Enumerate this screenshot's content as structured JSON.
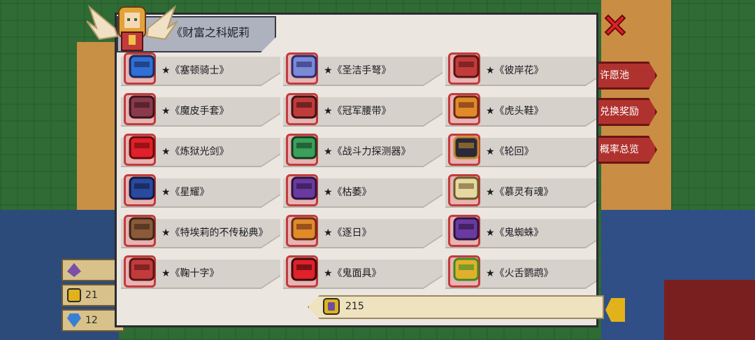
{
  "panel": {
    "title": "《财富之科妮莉",
    "title_full": "《财富之科妮莉亚》"
  },
  "side_menu": [
    {
      "label": "许愿池"
    },
    {
      "label": "兑换奖励"
    },
    {
      "label": "概率总览"
    }
  ],
  "currencies": [
    {
      "icon": "purple-gem-icon",
      "value": ""
    },
    {
      "icon": "gold-coin-icon",
      "value": "21"
    },
    {
      "icon": "blue-diamond-icon",
      "value": "12"
    }
  ],
  "items": [
    {
      "name": "★《塞顿骑士》",
      "icon": "blue-knight-helmet-icon"
    },
    {
      "name": "★《圣洁手弩》",
      "icon": "holy-crossbow-icon"
    },
    {
      "name": "★《彼岸花》",
      "icon": "red-spider-lily-icon"
    },
    {
      "name": "★《魔皮手套》",
      "icon": "demon-glove-icon"
    },
    {
      "name": "★《冠军腰带》",
      "icon": "champion-belt-icon"
    },
    {
      "name": "★《虎头鞋》",
      "icon": "tiger-head-shoe-icon"
    },
    {
      "name": "★《炼狱光剑》",
      "icon": "purgatory-lightsaber-icon"
    },
    {
      "name": "★《战斗力探测器》",
      "icon": "power-scanner-icon"
    },
    {
      "name": "★《轮回》",
      "icon": "reincarnation-claw-icon"
    },
    {
      "name": "★《星耀》",
      "icon": "star-cape-icon"
    },
    {
      "name": "★《枯萎》",
      "icon": "wither-bat-cape-icon"
    },
    {
      "name": "★《慕灵有魂》",
      "icon": "spirit-robe-icon"
    },
    {
      "name": "★《特埃莉的不传秘典》",
      "icon": "secret-book-icon"
    },
    {
      "name": "★《逐日》",
      "icon": "sun-chaser-bow-icon"
    },
    {
      "name": "★《鬼蜘蛛》",
      "icon": "ghost-spider-gun-icon"
    },
    {
      "name": "★《鞠十字》",
      "icon": "cross-target-icon"
    },
    {
      "name": "★《鬼面具》",
      "icon": "ghost-mask-icon"
    },
    {
      "name": "★《火舌鹦鹉》",
      "icon": "fire-parrot-gun-icon"
    }
  ],
  "bottom": {
    "value": "215",
    "icon": "gold-coin-icon"
  },
  "colors": {
    "slot_border": "#c23b3b",
    "slot_fill": "#e7b3b3",
    "panel": "#ece6e0",
    "close": "#e0202a"
  }
}
